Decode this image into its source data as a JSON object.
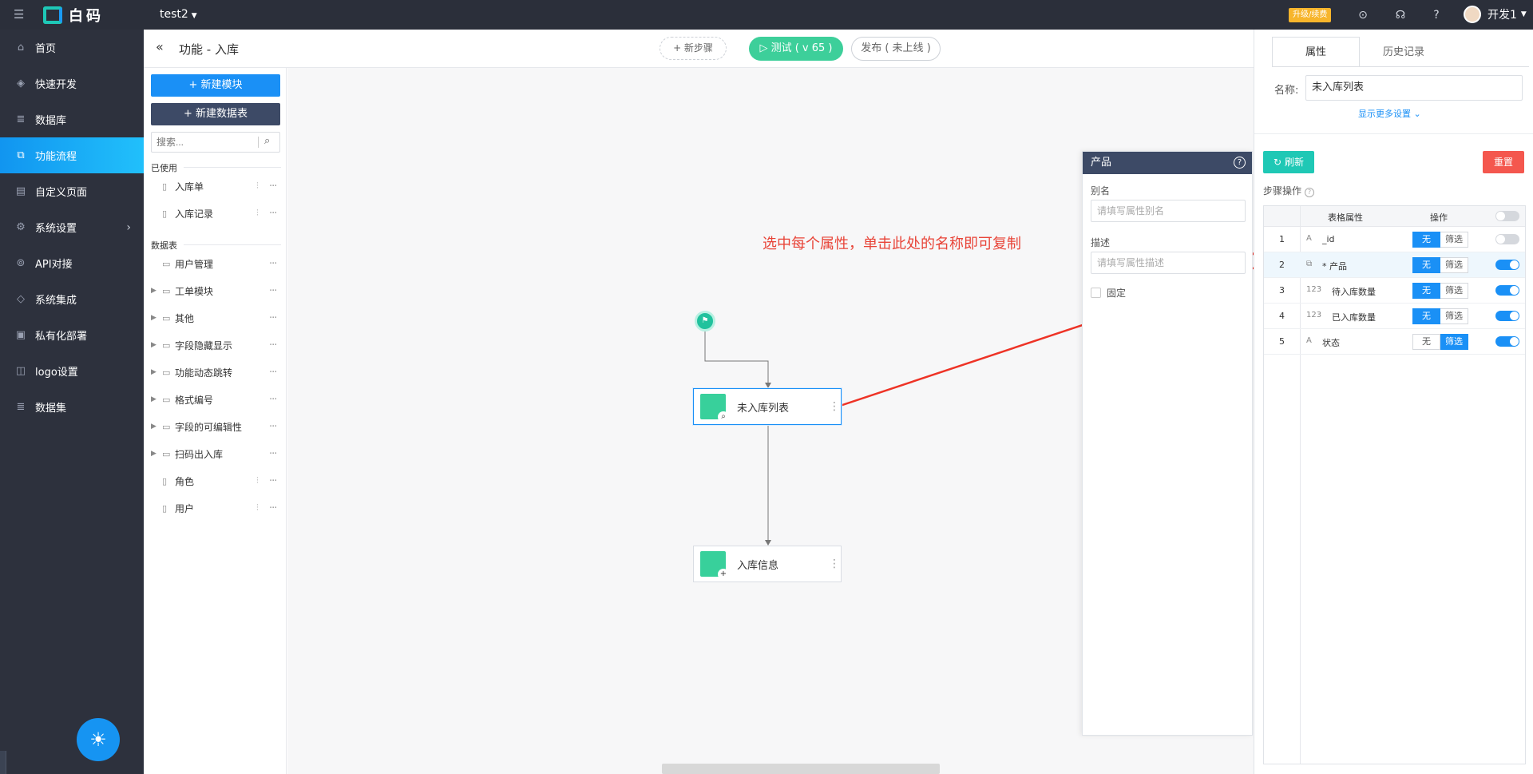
{
  "topbar": {
    "logo_text": "白码",
    "app_name": "test2",
    "upgrade_label": "升级/续费",
    "user_name": "开发1"
  },
  "sidebar": {
    "items": [
      {
        "label": "首页",
        "icon": "home-icon"
      },
      {
        "label": "快速开发",
        "icon": "cube-icon"
      },
      {
        "label": "数据库",
        "icon": "database-icon"
      },
      {
        "label": "功能流程",
        "icon": "flow-icon",
        "active": true
      },
      {
        "label": "自定义页面",
        "icon": "page-icon"
      },
      {
        "label": "系统设置",
        "icon": "settings-icon"
      },
      {
        "label": "API对接",
        "icon": "api-icon"
      },
      {
        "label": "系统集成",
        "icon": "layers-icon"
      },
      {
        "label": "私有化部署",
        "icon": "lock-icon"
      },
      {
        "label": "logo设置",
        "icon": "logo-icon"
      },
      {
        "label": "数据集",
        "icon": "dataset-icon"
      }
    ]
  },
  "header": {
    "title": "功能 - 入库",
    "new_step": "+ 新步骤",
    "test": "▷ 测试 ( v 65 )",
    "publish": "发布 ( 未上线 )"
  },
  "modules": {
    "new_module": "+ 新建模块",
    "new_table": "+ 新建数据表",
    "search_placeholder": "搜索...",
    "used_label": "已使用",
    "used_items": [
      "入库单",
      "入库记录"
    ],
    "tables_label": "数据表",
    "tables": [
      {
        "label": "用户管理",
        "type": "folder",
        "expandable": false
      },
      {
        "label": "工单模块",
        "type": "folder",
        "expandable": true
      },
      {
        "label": "其他",
        "type": "folder",
        "expandable": true
      },
      {
        "label": "字段隐藏显示",
        "type": "folder",
        "expandable": true
      },
      {
        "label": "功能动态跳转",
        "type": "folder",
        "expandable": true
      },
      {
        "label": "格式编号",
        "type": "folder",
        "expandable": true
      },
      {
        "label": "字段的可编辑性",
        "type": "folder",
        "expandable": true
      },
      {
        "label": "扫码出入库",
        "type": "folder",
        "expandable": true
      },
      {
        "label": "角色",
        "type": "file",
        "expandable": false
      },
      {
        "label": "用户",
        "type": "file",
        "expandable": false
      }
    ]
  },
  "canvas": {
    "nodes": [
      "未入库列表",
      "入库信息"
    ],
    "annotation": "选中每个属性，单击此处的名称即可复制"
  },
  "field_panel": {
    "title": "产品",
    "alias_label": "别名",
    "alias_placeholder": "请填写属性别名",
    "desc_label": "描述",
    "desc_placeholder": "请填写属性描述",
    "fixed_label": "固定"
  },
  "properties": {
    "tab_props": "属性",
    "tab_history": "历史记录",
    "name_label": "名称:",
    "name_value": "未入库列表",
    "more_settings": "显示更多设置",
    "refresh": "刷新",
    "reset": "重置",
    "step_ops": "步骤操作",
    "col_attr": "表格属性",
    "col_op": "操作",
    "rows": [
      {
        "num": "1",
        "type_icon": "A",
        "name": "_id",
        "mode": "无",
        "enabled": false
      },
      {
        "num": "2",
        "type_icon": "⧉",
        "name": "* 产品",
        "mode": "无",
        "enabled": true
      },
      {
        "num": "3",
        "type_icon": "123",
        "name": "待入库数量",
        "mode": "无",
        "enabled": true
      },
      {
        "num": "4",
        "type_icon": "123",
        "name": "已入库数量",
        "mode": "无",
        "enabled": true
      },
      {
        "num": "5",
        "type_icon": "A",
        "name": "状态",
        "mode": "筛选",
        "enabled": true
      }
    ],
    "seg_none": "无",
    "seg_filter": "筛选"
  },
  "colors": {
    "accent": "#1a90f6",
    "sidebar_bg": "#2d313d",
    "test_green": "#3dcf9a",
    "annotation_red": "#e84438"
  }
}
